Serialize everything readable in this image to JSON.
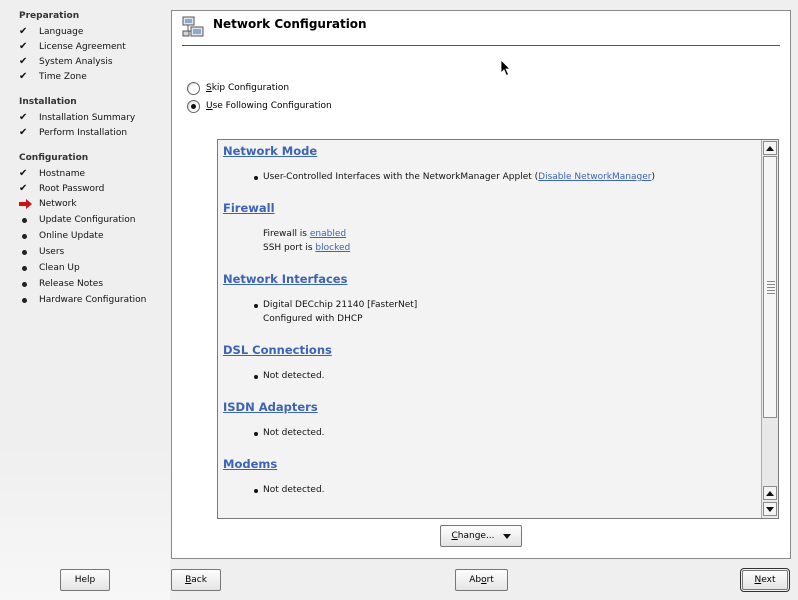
{
  "sidebar": {
    "sections": [
      {
        "title": "Preparation",
        "steps": [
          {
            "label": "Language",
            "status": "done"
          },
          {
            "label": "License Agreement",
            "status": "done"
          },
          {
            "label": "System Analysis",
            "status": "done"
          },
          {
            "label": "Time Zone",
            "status": "done"
          }
        ]
      },
      {
        "title": "Installation",
        "steps": [
          {
            "label": "Installation Summary",
            "status": "done"
          },
          {
            "label": "Perform Installation",
            "status": "done"
          }
        ]
      },
      {
        "title": "Configuration",
        "steps": [
          {
            "label": "Hostname",
            "status": "done"
          },
          {
            "label": "Root Password",
            "status": "done"
          },
          {
            "label": "Network",
            "status": "current"
          },
          {
            "label": "Update Configuration",
            "status": "pending"
          },
          {
            "label": "Online Update",
            "status": "pending"
          },
          {
            "label": "Users",
            "status": "pending"
          },
          {
            "label": "Clean Up",
            "status": "pending"
          },
          {
            "label": "Release Notes",
            "status": "pending"
          },
          {
            "label": "Hardware Configuration",
            "status": "pending"
          }
        ]
      }
    ]
  },
  "main": {
    "title": "Network Configuration",
    "options": {
      "skip_mnemonic": "S",
      "skip_rest": "kip Configuration",
      "use_mnemonic": "U",
      "use_rest": "se Following Configuration",
      "selected": "use"
    },
    "summary": {
      "network_mode": {
        "title": "Network Mode",
        "text_before": "User-Controlled Interfaces with the NetworkManager Applet (",
        "link": "Disable NetworkManager",
        "text_after": ")"
      },
      "firewall": {
        "title": "Firewall",
        "line1_prefix": "Firewall is ",
        "line1_link": "enabled",
        "line2_prefix": "SSH port is ",
        "line2_link": "blocked"
      },
      "interfaces": {
        "title": "Network Interfaces",
        "device": "Digital DECchip 21140 [FasterNet]",
        "config": "Configured with DHCP"
      },
      "dsl": {
        "title": "DSL Connections",
        "text": "Not detected."
      },
      "isdn": {
        "title": "ISDN Adapters",
        "text": "Not detected."
      },
      "modems": {
        "title": "Modems",
        "text": "Not detected."
      }
    },
    "change_button": {
      "mnemonic": "C",
      "rest": "hange..."
    }
  },
  "footer": {
    "help": "Help",
    "back_mnemonic": "B",
    "back_rest": "ack",
    "abort_pre": "Ab",
    "abort_mnemonic": "o",
    "abort_post": "rt",
    "next_mnemonic": "N",
    "next_rest": "ext"
  },
  "colors": {
    "link": "#3c64b3",
    "current_arrow": "#cc1111"
  }
}
